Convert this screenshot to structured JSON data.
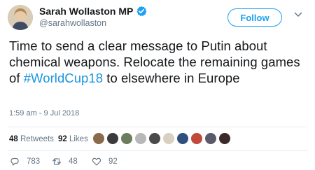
{
  "author": {
    "display_name": "Sarah Wollaston MP",
    "handle": "@sarahwollaston",
    "verified": true
  },
  "follow_button": {
    "label": "Follow"
  },
  "tweet": {
    "text_before": "Time to send a clear message to Putin about chemical weapons. Relocate the remaining games of ",
    "hashtag": "#WorldCup18",
    "text_after": " to elsewhere in Europe",
    "timestamp": "1:59 am - 9 Jul 2018"
  },
  "stats": {
    "retweets_count": "48",
    "retweets_label": "Retweets",
    "likes_count": "92",
    "likes_label": "Likes"
  },
  "engager_avatar_colors": [
    "#8a6a4a",
    "#3b3b3b",
    "#6b7d5c",
    "#b8b8b8",
    "#4a4a4a",
    "#d8d0c0",
    "#2f4f7f",
    "#c04a3a",
    "#5a5a6a",
    "#3a2a2a"
  ],
  "actions": {
    "reply_count": "783",
    "retweet_count": "48",
    "like_count": "92"
  },
  "colors": {
    "accent": "#1da1f2",
    "hashtag": "#1b95e0",
    "verified_badge": "#1da1f2",
    "secondary_text": "#657786"
  }
}
